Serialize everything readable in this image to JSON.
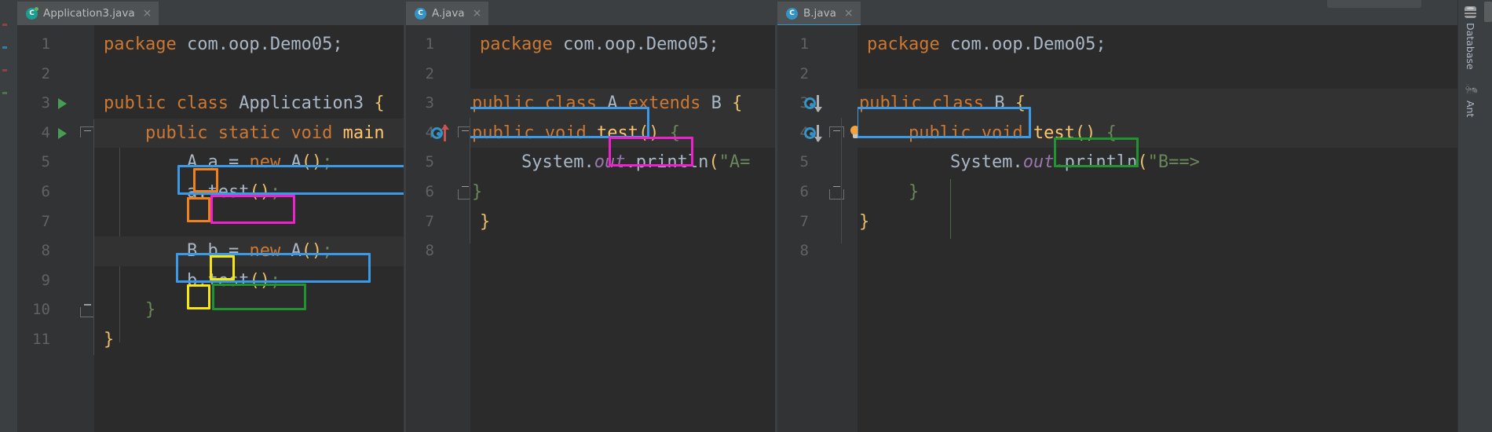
{
  "app": {
    "theme_bg": "#2b2b2b",
    "chrome_bg": "#3c3f41",
    "accent": "#3592c4"
  },
  "panes": [
    {
      "id": "pane-application3",
      "tab": {
        "label": "Application3.java",
        "icon": "java-class-icon",
        "close": "×",
        "active": false,
        "icon_color": "#1a9e8f"
      },
      "inspection_ok": "✓",
      "lines": [
        {
          "num": "1",
          "text": "package com.oop.Demo05;"
        },
        {
          "num": "2",
          "text": ""
        },
        {
          "num": "3",
          "text": "public class Application3 {"
        },
        {
          "num": "4",
          "text": "    public static void main"
        },
        {
          "num": "5",
          "text": "        A a = new A();"
        },
        {
          "num": "6",
          "text": "        a.test();"
        },
        {
          "num": "7",
          "text": ""
        },
        {
          "num": "8",
          "text": "        B b = new A();"
        },
        {
          "num": "9",
          "text": "        b.test();"
        },
        {
          "num": "10",
          "text": "    }"
        },
        {
          "num": "11",
          "text": "}"
        }
      ]
    },
    {
      "id": "pane-a",
      "tab": {
        "label": "A.java",
        "icon": "java-class-icon",
        "close": "×",
        "active": false,
        "icon_color": "#3592c4"
      },
      "inspection_ok": "✓",
      "lines": [
        {
          "num": "1",
          "text": "package com.oop.Demo05;"
        },
        {
          "num": "2",
          "text": ""
        },
        {
          "num": "3",
          "text": "public class A extends B {"
        },
        {
          "num": "4",
          "text": "public void test() {"
        },
        {
          "num": "5",
          "text": "    System.out.println(\"A="
        },
        {
          "num": "6",
          "text": "}"
        },
        {
          "num": "7",
          "text": " }"
        },
        {
          "num": "8",
          "text": ""
        }
      ]
    },
    {
      "id": "pane-b",
      "tab": {
        "label": "B.java",
        "icon": "java-class-icon",
        "close": "×",
        "active": true,
        "icon_color": "#3592c4"
      },
      "inspection_ok": "✓",
      "lines": [
        {
          "num": "1",
          "text": "package com.oop.Demo05;"
        },
        {
          "num": "2",
          "text": ""
        },
        {
          "num": "3",
          "text": "public class B {"
        },
        {
          "num": "4",
          "text": "    public void test() {"
        },
        {
          "num": "5",
          "text": "        System.out.println(\"B==>"
        },
        {
          "num": "6",
          "text": "    }"
        },
        {
          "num": "7",
          "text": "}"
        },
        {
          "num": "8",
          "text": ""
        }
      ]
    }
  ],
  "annotations": {
    "colors": {
      "blue": "#3a9ae8",
      "orange": "#f0821e",
      "magenta": "#ee22cc",
      "yellow": "#f5e511",
      "green": "#1f9431"
    }
  },
  "gutter_icons": {
    "run": "run-triangle-icon",
    "overridden_up": "overridden-method-up-icon",
    "overriding_down": "implemented-method-down-icon",
    "bulb": "intention-bulb-icon",
    "fold": "code-fold-icon"
  },
  "right_toolbar": {
    "items": [
      {
        "label": "Database",
        "icon": "database-icon"
      },
      {
        "label": "Ant",
        "icon": "ant-icon"
      }
    ]
  }
}
